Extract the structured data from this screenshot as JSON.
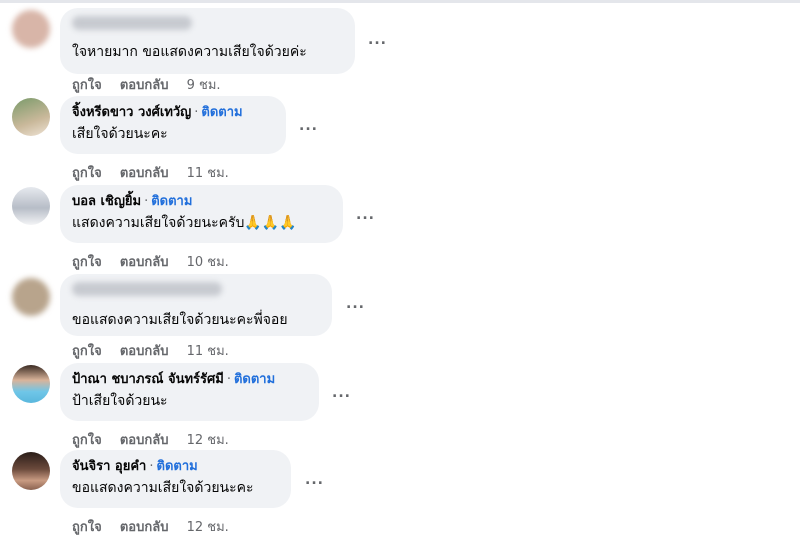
{
  "comments": [
    {
      "name": "",
      "follow": "",
      "text": "ใจหายมาก ขอแสดงความเสียใจด้วยค่ะ",
      "like": "ถูกใจ",
      "reply": "ตอบกลับ",
      "time": "9 ชม.",
      "more": "..."
    },
    {
      "name": "จิ้งหรีดขาว วงศ์เทวัญ",
      "follow": "ติดตาม",
      "text": "เสียใจด้วยนะคะ",
      "like": "ถูกใจ",
      "reply": "ตอบกลับ",
      "time": "11 ชม.",
      "more": "..."
    },
    {
      "name": "บอล เชิญยิ้ม",
      "follow": "ติดตาม",
      "text": "แสดงความเสียใจด้วยนะครับ🙏🙏🙏",
      "like": "ถูกใจ",
      "reply": "ตอบกลับ",
      "time": "10 ชม.",
      "more": "..."
    },
    {
      "name": "",
      "follow": "",
      "text": "ขอแสดงความเสียใจด้วยนะคะพี่จอย",
      "like": "ถูกใจ",
      "reply": "ตอบกลับ",
      "time": "11 ชม.",
      "more": "..."
    },
    {
      "name": "ป้าณา ชบาภรณ์ จันทร์รัศมี",
      "follow": "ติดตาม",
      "text": "ป้าเสียใจด้วยนะ",
      "like": "ถูกใจ",
      "reply": "ตอบกลับ",
      "time": "12 ชม.",
      "more": "..."
    },
    {
      "name": "จันจิรา อุยคำ",
      "follow": "ติดตาม",
      "text": "ขอแสดงความเสียใจด้วยนะคะ",
      "like": "ถูกใจ",
      "reply": "ตอบกลับ",
      "time": "12 ชม.",
      "more": "..."
    }
  ],
  "colors": {
    "bubble": "#f0f2f5",
    "follow": "#216fdb",
    "meta": "#65676b"
  }
}
